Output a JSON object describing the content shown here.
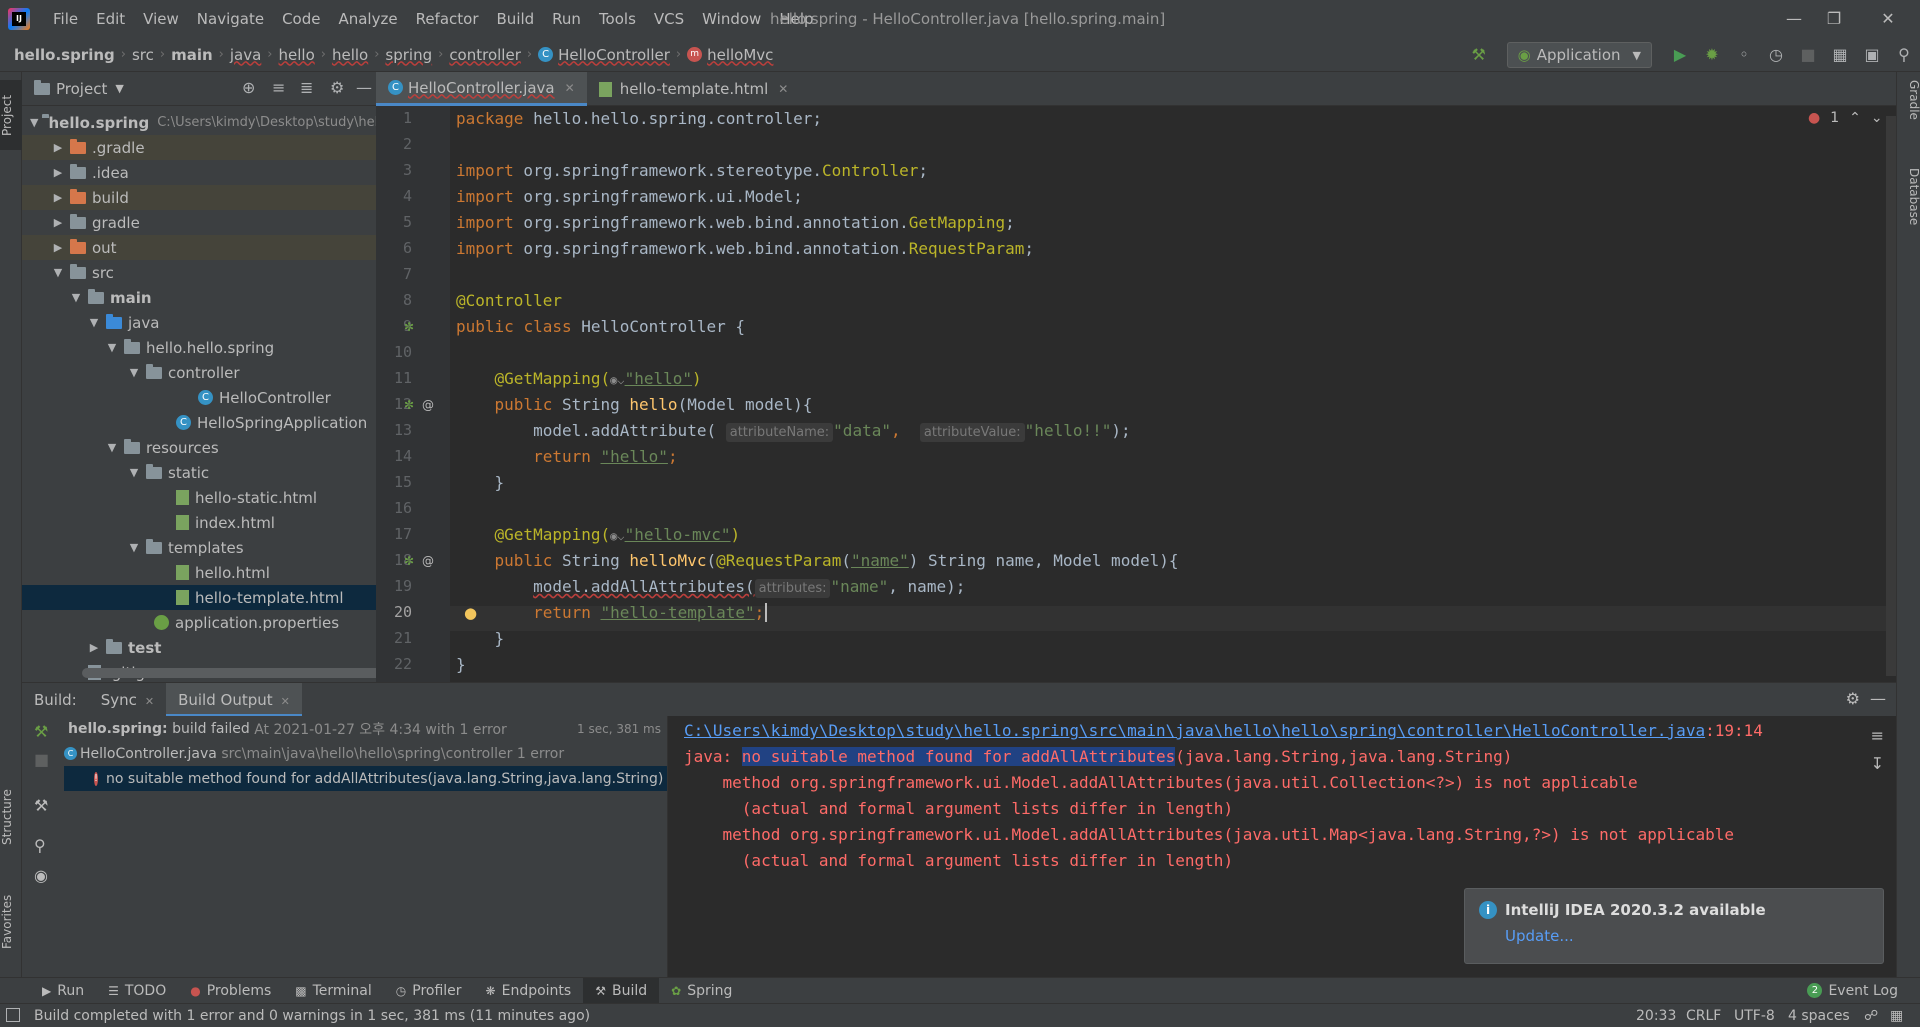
{
  "window": {
    "title": "hello.spring - HelloController.java [hello.spring.main]",
    "menu": [
      "File",
      "Edit",
      "View",
      "Navigate",
      "Code",
      "Analyze",
      "Refactor",
      "Build",
      "Run",
      "Tools",
      "VCS",
      "Window",
      "Help"
    ]
  },
  "breadcrumb": [
    "hello.spring",
    "src",
    "main",
    "java",
    "hello",
    "hello",
    "spring",
    "controller",
    "HelloController",
    "helloMvc"
  ],
  "run_config": "Application",
  "project": {
    "title": "Project",
    "root_name": "hello.spring",
    "root_path": "C:\\Users\\kimdy\\Desktop\\study\\hello.sp",
    "items": [
      ".gradle",
      ".idea",
      "build",
      "gradle",
      "out",
      "src",
      "main",
      "java",
      "hello.hello.spring",
      "controller",
      "HelloController",
      "HelloSpringApplication",
      "resources",
      "static",
      "hello-static.html",
      "index.html",
      "templates",
      "hello.html",
      "hello-template.html",
      "application.properties",
      "test",
      ".gitignore"
    ]
  },
  "editor": {
    "tabs": [
      "HelloController.java",
      "hello-template.html"
    ],
    "error_count": "1",
    "line_numbers": [
      "1",
      "2",
      "3",
      "4",
      "5",
      "6",
      "7",
      "8",
      "9",
      "10",
      "11",
      "12",
      "13",
      "14",
      "15",
      "16",
      "17",
      "18",
      "19",
      "20",
      "21",
      "22"
    ],
    "code": {
      "l1_kw": "package",
      "l1_rest": " hello.hello.spring.controller;",
      "import_kw": "import",
      "l3_pkg": " org.springframework.stereotype.",
      "l3_cls": "Controller",
      "l4_rest": " org.springframework.ui.Model;",
      "l5_pkg": " org.springframework.web.bind.annotation.",
      "l5_cls": "GetMapping",
      "l6_pkg": " org.springframework.web.bind.annotation.",
      "l6_cls": "RequestParam",
      "semicolon": ";",
      "l8_ann": "@Controller",
      "public_kw": "public",
      "class_kw": "class",
      "l9_rest": " HelloController {",
      "getmapping_ann": "@GetMapping(",
      "l11_str": "\"hello\"",
      "close_paren": ")",
      "string_type": " String ",
      "l12_method": "hello",
      "l12_rest": "(Model model){",
      "l13_call": "model.addAttribute(",
      "hint_attr_name": "attributeName:",
      "l13_str1": "\"data\"",
      "comma": ", ",
      "hint_attr_value": "attributeValue:",
      "l13_str2": "\"hello!!\"",
      "close_stmt": ");",
      "return_kw": "return",
      "l14_str": "\"hello\"",
      "close_brace": "}",
      "l17_str": "\"hello-mvc\"",
      "l18_method": "helloMvc",
      "l18_paren": "(",
      "l18_ann": "@RequestParam",
      "l18_open": "(",
      "l18_str": "\"name\"",
      "l18_rest": ") String name, Model model){",
      "l19_call": "model.addAllAttributes(",
      "hint_attributes": "attributes:",
      "l19_str": "\"name\"",
      "l19_rest": ", name);",
      "l20_str": "\"hello-template\""
    }
  },
  "build": {
    "label": "Build:",
    "tabs": [
      "Sync",
      "Build Output"
    ],
    "tree": {
      "project": "hello.spring:",
      "status": "build failed",
      "time": "At 2021-01-27 오후 4:34 with 1 error",
      "duration": "1 sec, 381 ms",
      "file": "HelloController.java",
      "file_path": "src\\main\\java\\hello\\hello\\spring\\controller 1 error",
      "error": "no suitable method found for addAllAttributes(java.lang.String,java.lang.String) :1"
    },
    "output": {
      "path": "C:\\Users\\kimdy\\Desktop\\study\\hello.spring\\src\\main\\java\\hello\\hello\\spring\\controller\\HelloController.java",
      "pos": ":19:14",
      "prefix": "java: ",
      "selected": "no suitable method found for addAllAttributes",
      "error_rest": "(java.lang.String,java.lang.String)",
      "line3": "    method org.springframework.ui.Model.addAllAttributes(java.util.Collection<?>) is not applicable",
      "line4": "      (actual and formal argument lists differ in length)",
      "line5": "    method org.springframework.ui.Model.addAllAttributes(java.util.Map<java.lang.String,?>) is not applicable",
      "line6": "      (actual and formal argument lists differ in length)"
    }
  },
  "notification": {
    "title": "IntelliJ IDEA 2020.3.2 available",
    "link": "Update..."
  },
  "side_tabs": {
    "left": [
      "Project",
      "Structure",
      "Favorites"
    ],
    "right": [
      "Gradle",
      "Database"
    ]
  },
  "tool_tabs": [
    "Run",
    "TODO",
    "Problems",
    "Terminal",
    "Profiler",
    "Endpoints",
    "Build",
    "Spring"
  ],
  "event_log": {
    "count": "2",
    "label": "Event Log"
  },
  "status": {
    "message": "Build completed with 1 error and 0 warnings in 1 sec, 381 ms (11 minutes ago)",
    "position": "20:33",
    "line_sep": "CRLF",
    "encoding": "UTF-8",
    "indent": "4 spaces"
  },
  "colors": {
    "accent": "#4a88c7",
    "error": "#ff6b68",
    "keyword": "#cc7832",
    "string": "#6a8759",
    "annotation": "#bbb529"
  }
}
